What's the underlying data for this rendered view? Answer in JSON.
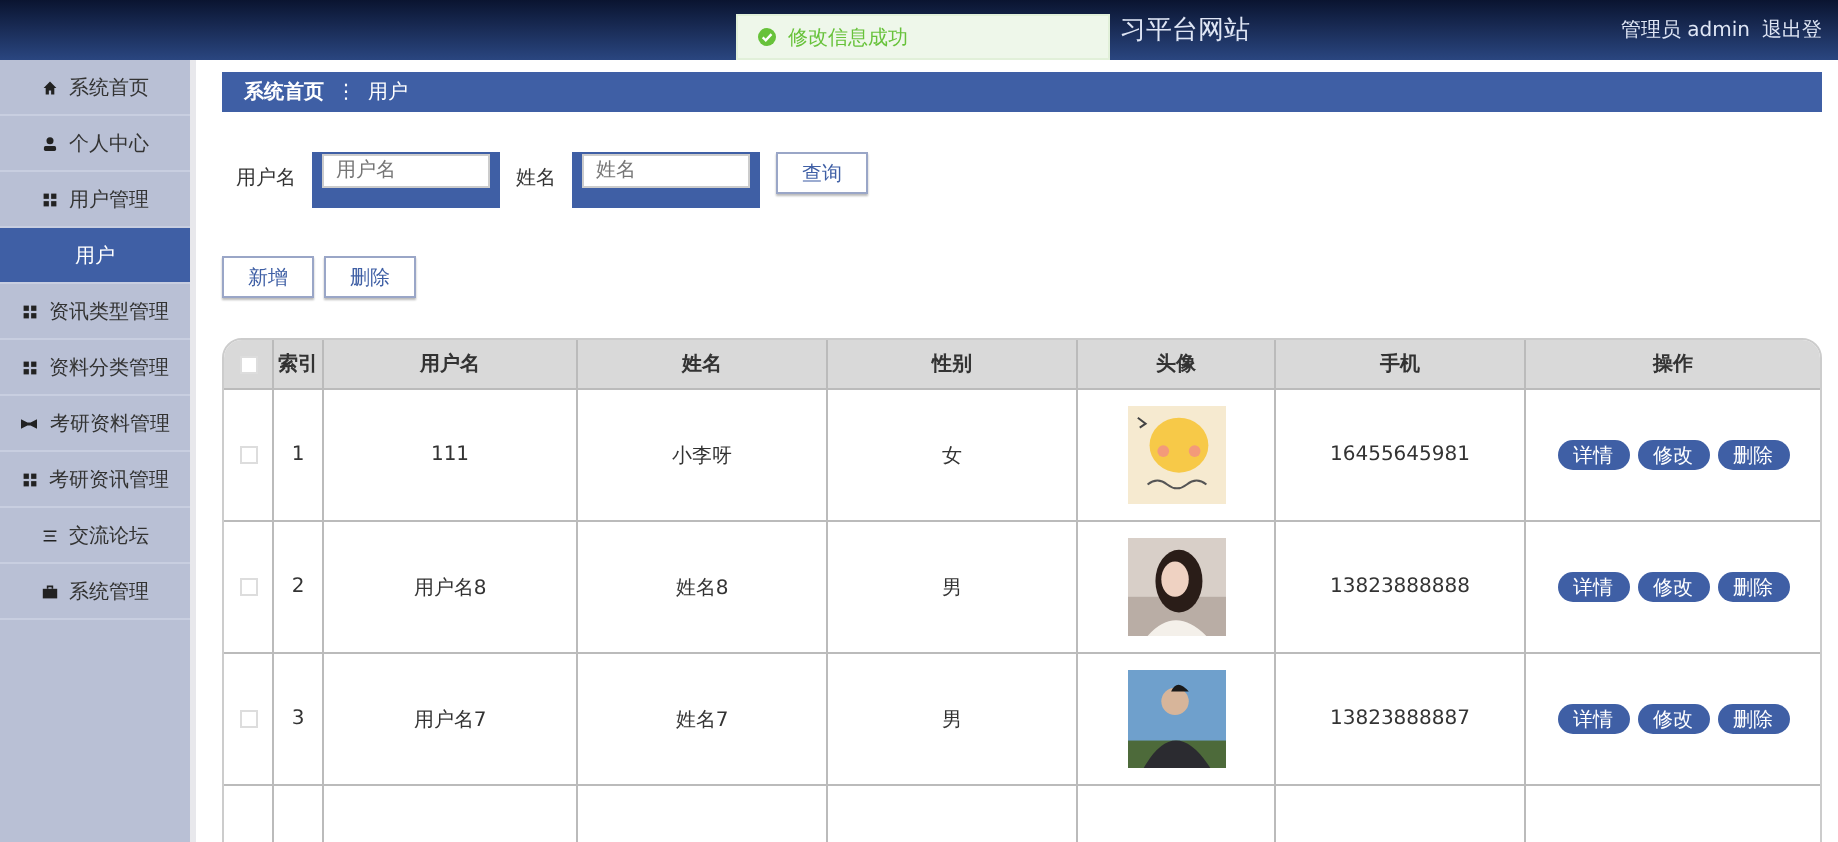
{
  "header": {
    "title": "习平台网站",
    "user": "管理员 admin",
    "logout": "退出登"
  },
  "toast": {
    "message": "修改信息成功"
  },
  "sidebar": {
    "items": [
      {
        "label": "系统首页",
        "kind": "home",
        "selected": false
      },
      {
        "label": "个人中心",
        "kind": "person",
        "selected": false
      },
      {
        "label": "用户管理",
        "kind": "grid",
        "selected": false
      },
      {
        "label": "用户",
        "kind": "sub",
        "selected": true
      },
      {
        "label": "资讯类型管理",
        "kind": "grid",
        "selected": false
      },
      {
        "label": "资料分类管理",
        "kind": "grid",
        "selected": false
      },
      {
        "label": "考研资料管理",
        "kind": "bowtie",
        "selected": false
      },
      {
        "label": "考研资讯管理",
        "kind": "grid",
        "selected": false
      },
      {
        "label": "交流论坛",
        "kind": "lines",
        "selected": false
      },
      {
        "label": "系统管理",
        "kind": "briefcase",
        "selected": false
      }
    ]
  },
  "breadcrumb": {
    "home": "系统首页",
    "separator": "⋮",
    "current": "用户"
  },
  "search": {
    "fields": [
      {
        "label": "用户名",
        "placeholder": "用户名"
      },
      {
        "label": "姓名",
        "placeholder": "姓名"
      }
    ],
    "button": "查询"
  },
  "actions": [
    "新增",
    "删除"
  ],
  "table": {
    "select_all_checked": false,
    "columns": [
      "索引",
      "用户名",
      "姓名",
      "性别",
      "头像",
      "手机",
      "操作"
    ],
    "rows": [
      {
        "checked": false,
        "index": "1",
        "username": "111",
        "name": "小李呀",
        "gender": "女",
        "phone": "16455645981",
        "buttons": [
          "详情",
          "修改",
          "删除"
        ]
      },
      {
        "checked": false,
        "index": "2",
        "username": "用户名8",
        "name": "姓名8",
        "gender": "男",
        "phone": "13823888888",
        "buttons": [
          "详情",
          "修改",
          "删除"
        ]
      },
      {
        "checked": false,
        "index": "3",
        "username": "用户名7",
        "name": "姓名7",
        "gender": "男",
        "phone": "13823888887",
        "buttons": [
          "详情",
          "修改",
          "删除"
        ]
      }
    ]
  }
}
